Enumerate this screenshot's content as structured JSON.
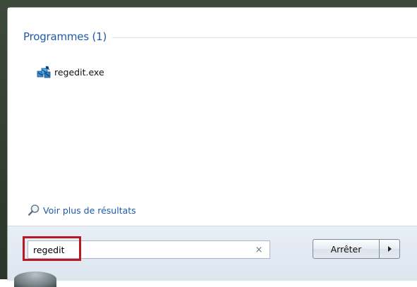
{
  "results": {
    "group_title": "Programmes (1)",
    "items": [
      {
        "label": "regedit.exe",
        "icon": "registry-editor-icon"
      }
    ],
    "more_results_label": "Voir plus de résultats"
  },
  "search": {
    "value": "regedit",
    "clear_icon": "×"
  },
  "shutdown": {
    "label": "Arrêter"
  },
  "colors": {
    "link_blue": "#1e5aa8",
    "highlight_red": "#b71a23",
    "search_bar_bg": "#e2e9f2"
  }
}
